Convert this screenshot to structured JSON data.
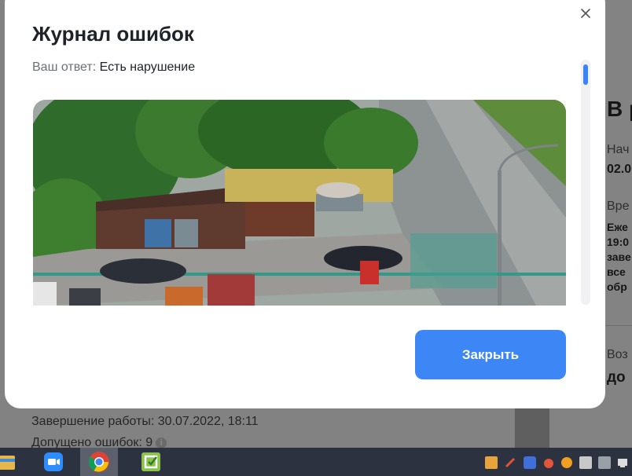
{
  "background_page": {
    "right_panel": {
      "title": "В р",
      "start_label": "Нач",
      "start_value": "02.0",
      "time_label": "Вре",
      "time_lines": [
        "Еже",
        "19:0",
        "заве",
        "все",
        "обр"
      ],
      "reward_label": "Воз",
      "reward_value": "до"
    },
    "stats": {
      "finish": "Завершение работы: 30.07.2022, 18:11",
      "errors": "Допущено ошибок: 9",
      "info_icon": "i"
    }
  },
  "modal": {
    "title": "Журнал ошибок",
    "answer_label": "Ваш ответ:",
    "answer_value": "Есть нарушение",
    "photo_alt": "camera-snapshot",
    "close_button": "Закрыть",
    "close_icon": "close-icon"
  },
  "taskbar": {
    "apps": [
      "file-manager-icon",
      "zoom-icon",
      "chrome-icon",
      "green-app-icon"
    ],
    "tray_icons": [
      "s-tray-icon",
      "pen-tray-icon",
      "yandex-tray-icon",
      "fire-tray-icon",
      "orange-tray-icon",
      "monitor-tray-icon",
      "drive-tray-icon",
      "network-tray-icon"
    ]
  },
  "colors": {
    "accent": "#3d86f5",
    "overlay": "#808080",
    "taskbar": "#2d3240"
  }
}
